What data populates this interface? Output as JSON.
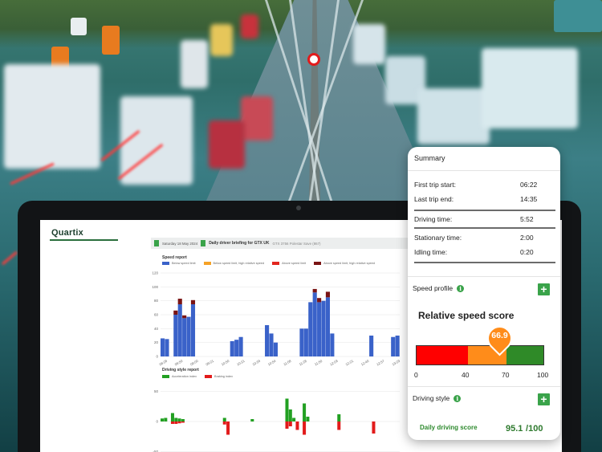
{
  "screen": {
    "logo": "Quartix",
    "briefing": {
      "date": "Saturday 18 May 2024",
      "title": "Daily driver briefing for GTX UK",
      "subtitle": "GTX 3756 Polestar Save (867)"
    },
    "speed_report": {
      "title": "Speed report",
      "legend": [
        {
          "label": "Below speed limit",
          "color": "#3a62c9"
        },
        {
          "label": "Below speed limit, high relative speed",
          "color": "#f5a227"
        },
        {
          "label": "Above speed limit",
          "color": "#e2261f"
        },
        {
          "label": "Above speed limit, high relative speed",
          "color": "#7a1414"
        }
      ]
    },
    "driving_style_report": {
      "title": "Driving style report",
      "legend": [
        {
          "label": "Acceleration index",
          "color": "#22a022"
        },
        {
          "label": "Braking index",
          "color": "#e21b1b"
        }
      ]
    }
  },
  "chart_data": [
    {
      "type": "bar",
      "title": "Speed report",
      "ylim": [
        0,
        120
      ],
      "yticks": [
        "120",
        "100",
        "80",
        "60",
        "40",
        "20",
        "0"
      ],
      "xticks": [
        "08:28",
        "08:50",
        "09:00",
        "09:21",
        "10:50",
        "10:21",
        "10:33",
        "10:54",
        "11:08",
        "11:28",
        "11:50",
        "12:03",
        "12:21",
        "12:40",
        "12:57",
        "13:23"
      ],
      "values": [
        26,
        25,
        0,
        60,
        75,
        55,
        57,
        75,
        0,
        0,
        0,
        0,
        0,
        0,
        0,
        0,
        22,
        24,
        28,
        0,
        0,
        0,
        0,
        0,
        45,
        33,
        20,
        0,
        0,
        0,
        0,
        0,
        40,
        40,
        78,
        92,
        78,
        80,
        85,
        33,
        0,
        0,
        0,
        0,
        0,
        0,
        0,
        0,
        30,
        0,
        0,
        0,
        0,
        28,
        30
      ],
      "above_values": [
        0,
        0,
        0,
        6,
        8,
        4,
        0,
        6,
        0,
        0,
        0,
        0,
        0,
        0,
        0,
        0,
        0,
        0,
        0,
        0,
        0,
        0,
        0,
        0,
        0,
        0,
        0,
        0,
        0,
        0,
        0,
        0,
        0,
        0,
        0,
        5,
        6,
        0,
        8,
        0,
        0,
        0,
        0,
        0,
        0,
        0,
        0,
        0,
        0,
        0,
        0,
        0,
        0,
        0,
        0
      ]
    },
    {
      "type": "bar",
      "title": "Driving style report",
      "ylim": [
        -60,
        60
      ],
      "yticks": [
        "50",
        "0",
        "-50"
      ],
      "series": [
        {
          "name": "Acceleration index",
          "values": [
            5,
            6,
            0,
            14,
            6,
            5,
            4,
            0,
            0,
            0,
            0,
            0,
            0,
            0,
            0,
            0,
            0,
            0,
            6,
            0,
            0,
            0,
            0,
            0,
            0,
            0,
            4,
            0,
            0,
            0,
            0,
            0,
            0,
            0,
            0,
            0,
            38,
            20,
            6,
            0,
            0,
            30,
            8,
            0,
            0,
            0,
            0,
            0,
            0,
            0,
            0,
            12,
            0,
            0,
            0,
            0,
            0,
            0,
            0,
            0,
            0,
            0,
            0,
            0,
            0,
            0,
            0,
            0,
            0
          ]
        },
        {
          "name": "Braking index",
          "values": [
            0,
            0,
            0,
            -4,
            -4,
            -3,
            -2,
            0,
            0,
            0,
            0,
            0,
            0,
            0,
            0,
            0,
            0,
            0,
            -5,
            -22,
            0,
            0,
            0,
            0,
            0,
            0,
            0,
            0,
            0,
            0,
            0,
            0,
            0,
            0,
            0,
            0,
            -12,
            -8,
            0,
            -14,
            0,
            -22,
            0,
            0,
            0,
            0,
            0,
            0,
            0,
            0,
            0,
            -14,
            0,
            0,
            0,
            0,
            0,
            0,
            0,
            0,
            0,
            -20,
            0,
            0,
            0,
            0,
            0,
            0,
            0
          ]
        }
      ]
    }
  ],
  "summary": {
    "title": "Summary",
    "first_trip_label": "First trip start:",
    "first_trip_value": "06:22",
    "last_trip_label": "Last trip end:",
    "last_trip_value": "14:35",
    "driving_time_label": "Driving time:",
    "driving_time_value": "5:52",
    "stationary_label": "Stationary time:",
    "stationary_value": "2:00",
    "idling_label": "Idling time:",
    "idling_value": "0:20",
    "speed_profile_label": "Speed profile",
    "relative_speed_title": "Relative speed score",
    "relative_speed_score": "66.9",
    "scale": [
      "0",
      "40",
      "70",
      "100"
    ],
    "driving_style_label": "Driving style",
    "daily_score_label": "Daily driving score",
    "daily_score_value": "95.1",
    "daily_score_max": "/100"
  }
}
